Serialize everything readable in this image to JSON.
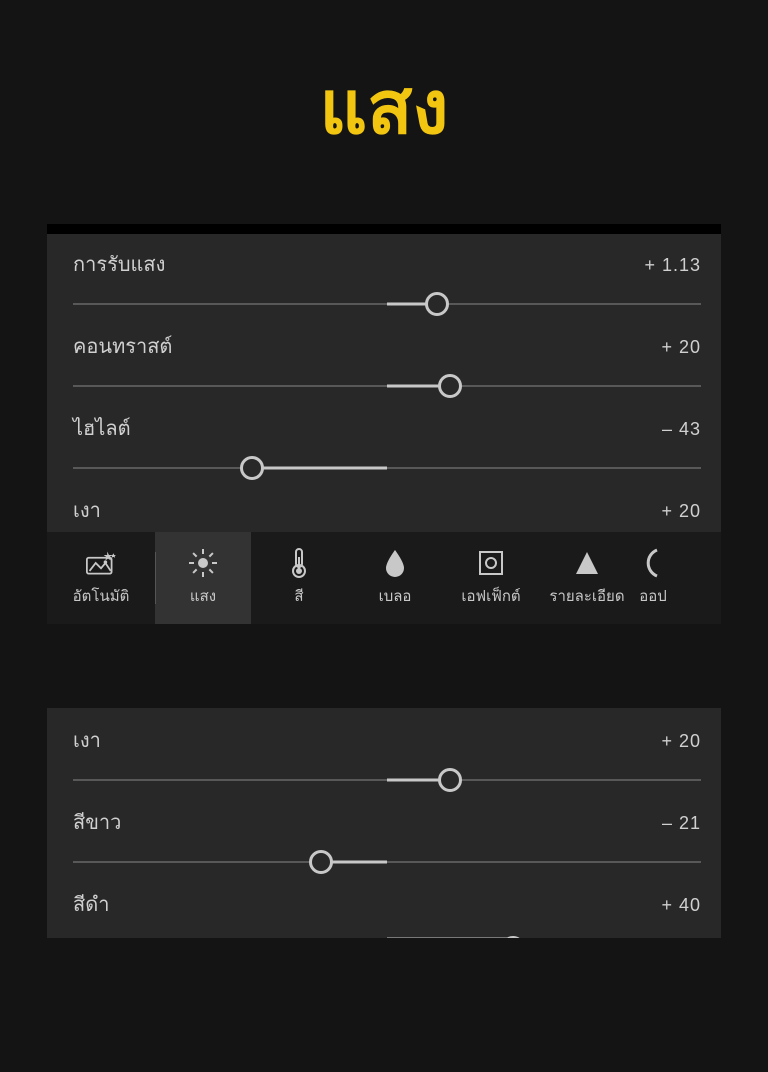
{
  "title": "แสง",
  "panel1": {
    "sliders": [
      {
        "label": "การรับแสง",
        "value": "+ 1.13",
        "knob": 58,
        "rangeStart": 50,
        "rangeEnd": 58
      },
      {
        "label": "คอนทราสต์",
        "value": "+ 20",
        "knob": 60,
        "rangeStart": 50,
        "rangeEnd": 60
      },
      {
        "label": "ไฮไลต์",
        "value": "– 43",
        "knob": 28.5,
        "rangeStart": 28.5,
        "rangeEnd": 50
      },
      {
        "label": "เงา",
        "value": "+ 20",
        "knob": 60,
        "rangeStart": 50,
        "rangeEnd": 60,
        "clip": true
      }
    ]
  },
  "panel2": {
    "sliders": [
      {
        "label": "เงา",
        "value": "+ 20",
        "knob": 60,
        "rangeStart": 50,
        "rangeEnd": 60
      },
      {
        "label": "สีขาว",
        "value": "– 21",
        "knob": 39.5,
        "rangeStart": 39.5,
        "rangeEnd": 50
      },
      {
        "label": "สีดำ",
        "value": "+ 40",
        "knob": 70,
        "rangeStart": 50,
        "rangeEnd": 70,
        "clip": true
      }
    ]
  },
  "toolbar": {
    "items": [
      {
        "label": "อัตโนมัติ",
        "icon": "auto",
        "active": false,
        "divider": false
      },
      {
        "label": "แสง",
        "icon": "light",
        "active": true,
        "divider": true
      },
      {
        "label": "สี",
        "icon": "temp",
        "active": false,
        "divider": false
      },
      {
        "label": "เบลอ",
        "icon": "drop",
        "active": false,
        "divider": false
      },
      {
        "label": "เอฟเฟ็กต์",
        "icon": "effect",
        "active": false,
        "divider": false
      },
      {
        "label": "รายละเอียด",
        "icon": "detail",
        "active": false,
        "divider": false
      },
      {
        "label": "ออป",
        "icon": "optic",
        "active": false,
        "divider": false
      }
    ]
  }
}
